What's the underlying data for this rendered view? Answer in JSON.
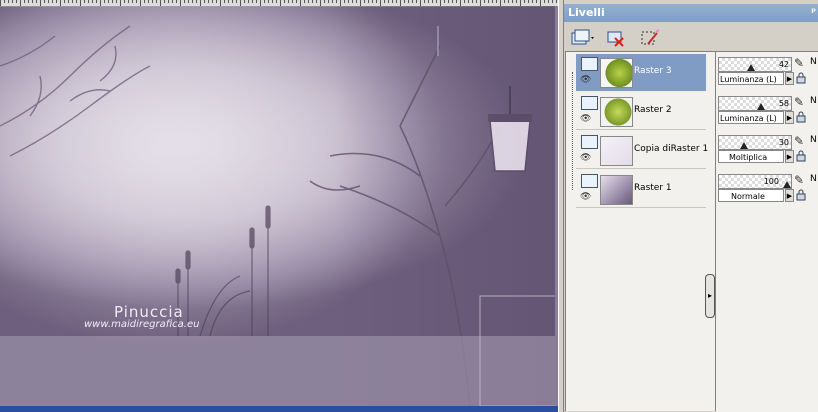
{
  "palette": {
    "title": "Livelli",
    "pin_glyph": "ᵖ",
    "toolbar": [
      {
        "icon": "new-layer-icon",
        "has_dropdown": true
      },
      {
        "icon": "delete-layer-icon",
        "has_dropdown": false
      },
      {
        "icon": "edit-selection-icon",
        "has_dropdown": false
      }
    ]
  },
  "layers": [
    {
      "name": "Raster 3",
      "selected": true,
      "opacity": 42,
      "blend_mode": "Luminanza (L)",
      "thumbnail": "green-leaves",
      "opacity_suffix": "N"
    },
    {
      "name": "Raster 2",
      "selected": false,
      "opacity": 58,
      "blend_mode": "Luminanza (L)",
      "thumbnail": "green-leaves",
      "opacity_suffix": "N"
    },
    {
      "name": "Copia diRaster 1",
      "selected": false,
      "opacity": 30,
      "blend_mode": "Moltiplica",
      "thumbnail": "pale-lavender",
      "opacity_suffix": "N"
    },
    {
      "name": "Raster 1",
      "selected": false,
      "opacity": 100,
      "blend_mode": "Normale",
      "thumbnail": "purple-gradient",
      "opacity_suffix": "N"
    }
  ],
  "canvas": {
    "watermark_name": "Pinuccia",
    "watermark_url": "www.maidiregrafica.eu",
    "colors": {
      "light": "#d8d2de",
      "mid": "#b9afc2",
      "dark": "#6e5f7e",
      "scrollbar": "#2a4fa0",
      "selection": "#809cc4"
    }
  }
}
